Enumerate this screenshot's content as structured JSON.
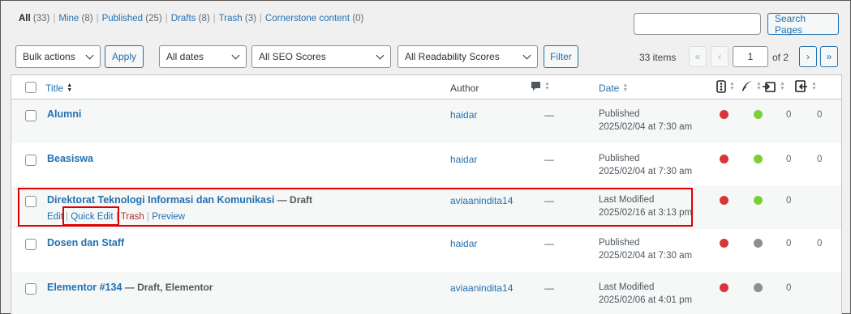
{
  "views": [
    {
      "label": "All",
      "count": "(33)",
      "current": true
    },
    {
      "label": "Mine",
      "count": "(8)"
    },
    {
      "label": "Published",
      "count": "(25)"
    },
    {
      "label": "Drafts",
      "count": "(8)"
    },
    {
      "label": "Trash",
      "count": "(3)"
    },
    {
      "label": "Cornerstone content",
      "count": "(0)"
    }
  ],
  "search": {
    "value": "",
    "button": "Search Pages"
  },
  "filters": {
    "bulk_actions": "Bulk actions",
    "apply": "Apply",
    "dates": "All dates",
    "seo": "All SEO Scores",
    "readability": "All Readability Scores",
    "filter": "Filter"
  },
  "pagination": {
    "items": "33 items",
    "first": "«",
    "prev": "‹",
    "current": "1",
    "of": "of 2",
    "next": "›",
    "last": "»"
  },
  "columns": {
    "title": "Title",
    "author": "Author",
    "date": "Date"
  },
  "colors": {
    "red": "#d63638",
    "green": "#7ad03a",
    "gray": "#8c8f94",
    "highlight": "#e00000"
  },
  "rows": [
    {
      "title": "Alumni",
      "state": "",
      "author": "haidar",
      "comments": "—",
      "date_status": "Published",
      "date": "2025/02/04 at 7:30 am",
      "seo": "red",
      "readability": "green",
      "links_out": "0",
      "links_in": "0"
    },
    {
      "title": "Beasiswa",
      "state": "",
      "author": "haidar",
      "comments": "—",
      "date_status": "Published",
      "date": "2025/02/04 at 7:30 am",
      "seo": "red",
      "readability": "green",
      "links_out": "0",
      "links_in": "0"
    },
    {
      "title": "Direktorat Teknologi Informasi dan Komunikasi",
      "state": " — Draft",
      "author": "aviaanindita14",
      "comments": "—",
      "date_status": "Last Modified",
      "date": "2025/02/16 at 3:13 pm",
      "seo": "red",
      "readability": "green",
      "links_out": "0",
      "links_in": "",
      "actions": {
        "edit": "Edit",
        "quick_edit": "Quick Edit",
        "trash": "Trash",
        "preview": "Preview"
      }
    },
    {
      "title": "Dosen dan Staff",
      "state": "",
      "author": "haidar",
      "comments": "—",
      "date_status": "Published",
      "date": "2025/02/04 at 7:30 am",
      "seo": "red",
      "readability": "gray",
      "links_out": "0",
      "links_in": "0"
    },
    {
      "title": "Elementor #134",
      "state": " — Draft, Elementor",
      "author": "aviaanindita14",
      "comments": "—",
      "date_status": "Last Modified",
      "date": "2025/02/06 at 4:01 pm",
      "seo": "red",
      "readability": "gray",
      "links_out": "0",
      "links_in": ""
    }
  ]
}
